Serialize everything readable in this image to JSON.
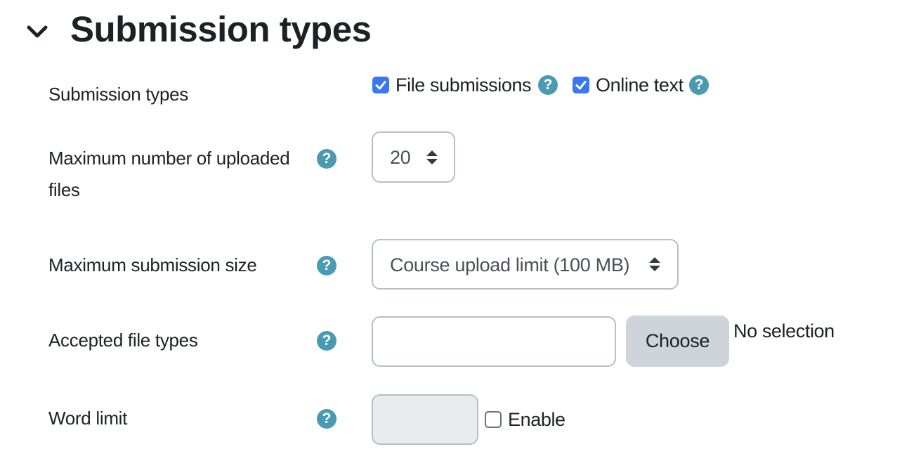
{
  "section": {
    "title": "Submission types",
    "expanded": true
  },
  "rows": {
    "submission_types": {
      "label": "Submission types",
      "options": [
        {
          "label": "File submissions",
          "checked": true
        },
        {
          "label": "Online text",
          "checked": true
        }
      ]
    },
    "max_files": {
      "label_line1": "Maximum number of uploaded",
      "label_line2": "files",
      "value": "20"
    },
    "max_size": {
      "label": "Maximum submission size",
      "value": "Course upload limit (100 MB)"
    },
    "file_types": {
      "label": "Accepted file types",
      "value": "",
      "button": "Choose",
      "status": "No selection"
    },
    "word_limit": {
      "label": "Word limit",
      "value": "",
      "enable_label": "Enable",
      "enabled": false
    }
  },
  "icons": {
    "help_glyph": "?",
    "help_color": "#4a9bb2",
    "checkbox_color": "#3a78f2"
  }
}
